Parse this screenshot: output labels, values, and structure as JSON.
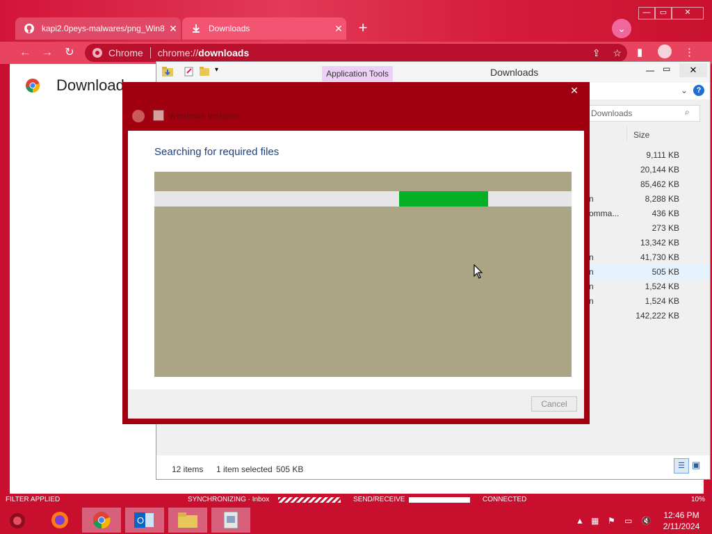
{
  "chrome": {
    "tabs": [
      {
        "label": "kapi2.0peys-malwares/png_Win8",
        "icon": "github-icon",
        "active": false
      },
      {
        "label": "Downloads",
        "icon": "download-icon",
        "active": true
      }
    ],
    "omnibox": {
      "site_label": "Chrome",
      "url_prefix": "chrome://",
      "url_path": "downloads"
    },
    "page_title": "Download"
  },
  "explorer": {
    "ribbon_tab": "Application Tools",
    "title": "Downloads",
    "search_placeholder": "Downloads",
    "column_size": "Size",
    "files": [
      {
        "name": "",
        "size": "9,111 KB"
      },
      {
        "name": "",
        "size": "20,144 KB"
      },
      {
        "name": "",
        "size": "85,462 KB"
      },
      {
        "name": "n",
        "size": "8,288 KB"
      },
      {
        "name": "omma...",
        "size": "436 KB"
      },
      {
        "name": "",
        "size": "273 KB"
      },
      {
        "name": "",
        "size": "13,342 KB"
      },
      {
        "name": "n",
        "size": "41,730 KB"
      },
      {
        "name": "n",
        "size": "505 KB",
        "selected": true
      },
      {
        "name": "n",
        "size": "1,524 KB"
      },
      {
        "name": "n",
        "size": "1,524 KB"
      },
      {
        "name": "",
        "size": "142,222 KB"
      }
    ],
    "status": {
      "items": "12 items",
      "selected": "1 item selected",
      "selected_size": "505 KB"
    }
  },
  "installer": {
    "title": "Windows Installer",
    "heading": "Searching for required files",
    "progress_start": 0.587,
    "progress_end": 0.8,
    "cancel_label": "Cancel"
  },
  "outlook_strip": {
    "filter": "FILTER APPLIED",
    "sync": "SYNCHRONIZING · Inbox",
    "send_receive": "SEND/RECEIVE",
    "connected": "CONNECTED",
    "zoom": "10%"
  },
  "taskbar": {
    "apps": [
      "firefox-icon",
      "chrome-icon",
      "outlook-icon",
      "file-explorer-icon",
      "installer-icon"
    ],
    "time": "12:46 PM",
    "date": "2/11/2024"
  },
  "colors": {
    "accent": "#c8102e",
    "progress": "#06b026",
    "dialog_frame": "#a0000f"
  }
}
